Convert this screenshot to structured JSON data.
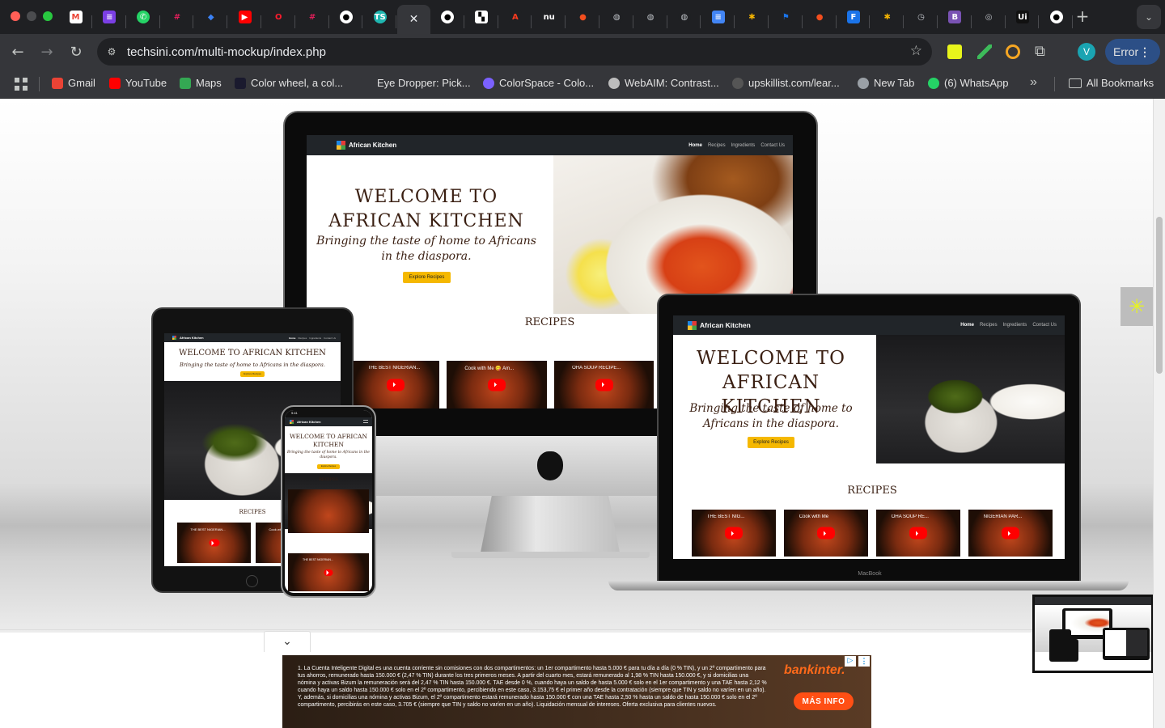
{
  "browser": {
    "url": "techsini.com/multi-mockup/index.php",
    "profile_initial": "V",
    "error_label": "Error",
    "tab_favicons": [
      "gmail",
      "notion",
      "whatsapp",
      "slack",
      "figma-diamond",
      "youtube",
      "opera",
      "slack",
      "github",
      "ts",
      "active-close",
      "github",
      "ts-bw",
      "adobe",
      "nu",
      "figma",
      "globe",
      "globe",
      "globe",
      "docs",
      "colorzilla",
      "flag",
      "figma",
      "flux",
      "colorzilla",
      "history",
      "bootstrap",
      "chrome",
      "ui",
      "github"
    ],
    "tab_labels": {
      "ts": "TS",
      "nu": "nu",
      "bootstrap": "B",
      "ui": "Ui"
    }
  },
  "bookmarks": [
    {
      "label": "Gmail",
      "icon": "gmail-icon"
    },
    {
      "label": "YouTube",
      "icon": "youtube-icon"
    },
    {
      "label": "Maps",
      "icon": "maps-icon"
    },
    {
      "label": "Color wheel, a col...",
      "icon": "colorwheel-icon"
    },
    {
      "label": "Eye Dropper: Pick...",
      "icon": "eyedropper-icon"
    },
    {
      "label": "ColorSpace - Colo...",
      "icon": "colorspace-icon"
    },
    {
      "label": "WebAIM: Contrast...",
      "icon": "gear-icon"
    },
    {
      "label": "upskillist.com/lear...",
      "icon": "loading-icon"
    },
    {
      "label": "New Tab",
      "icon": "globe-icon"
    },
    {
      "label": "(6) WhatsApp",
      "icon": "whatsapp-icon"
    }
  ],
  "bookmarks_overflow": "»",
  "all_bookmarks": "All Bookmarks",
  "site": {
    "brand": "African Kitchen",
    "nav_links": [
      "Home",
      "Recipes",
      "Ingredients",
      "Contact Us"
    ],
    "heading": "WELCOME TO AFRICAN KITCHEN",
    "tagline": "Bringing the taste of home to Africans in the diaspora.",
    "cta": "Explore Recipes",
    "recipes_heading": "RECIPES",
    "videos": [
      "THE BEST NIGERIAN...",
      "Cook with Me 😋 Am...",
      "OHA SOUP RECIPE...",
      "NIGERIAN PAR..."
    ],
    "videos_short": [
      "THE BEST NIG...",
      "Cook with Me",
      "OHA SOUP RE...",
      "NIGERIAN PAR..."
    ],
    "phone_time": "9:41"
  },
  "laptop_label": "MacBook",
  "ad": {
    "text": "1. La Cuenta Inteligente Digital es una cuenta corriente sin comisiones con dos compartimentos: un 1er compartimento hasta 5.000 € para tu día a día (0 % TIN), y un 2º compartimento para tus ahorros, remunerado hasta 150.000 € (2,47 % TIN) durante los tres primeros meses. A partir del cuarto mes, estará remunerado al 1,98 % TIN hasta 150.000 €, y si domicilias una nómina y activas Bizum la remuneración será del 2,47 % TIN hasta 150.000 €. TAE desde 0 %, cuando haya un saldo de hasta 5.000 € solo en el 1er compartimento y una TAE hasta 2,12 % cuando haya un saldo hasta 150.000 € solo en el 2º compartimento, percibiendo en este caso, 3.153,75 € el primer año desde la contratación (siempre que TIN y saldo no varíen en un año). Y, además, si domicilias una nómina y activas Bizum, el 2º compartimento estará remunerado hasta 150.000 € con una TAE hasta 2,50 % hasta un saldo de hasta 150.000 € solo en el 2º compartimento, percibirás en este caso, 3.705 € (siempre que TIN y saldo no varíen en un año). Liquidación mensual de intereses. Oferta exclusiva para clientes nuevos.",
    "brand": "bankinter.",
    "button": "MÁS INFO"
  },
  "colors": {
    "accent_yellow": "#f5b800",
    "site_nav": "#212529",
    "heading_brown": "#3a1f12",
    "ad_orange": "#ff4f14"
  }
}
